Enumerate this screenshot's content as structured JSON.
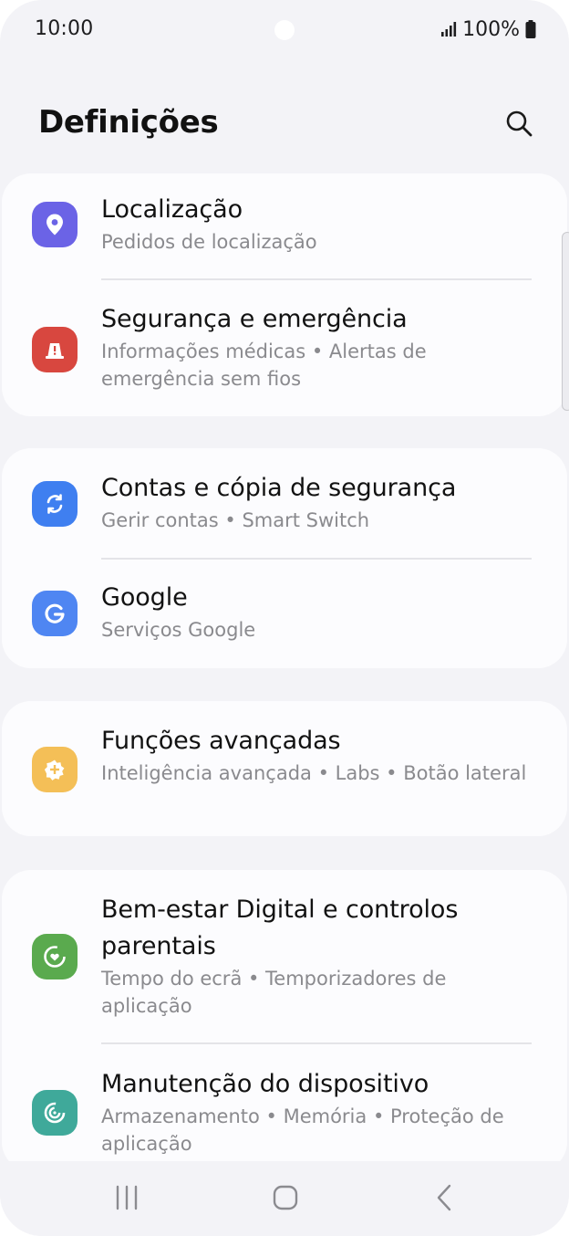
{
  "status_bar": {
    "time": "10:00",
    "battery": "100%",
    "icons": [
      "signal-icon",
      "battery-icon"
    ]
  },
  "header": {
    "title": "Definições",
    "search_icon": "search-icon"
  },
  "cards": [
    {
      "items": [
        {
          "title": "Localização",
          "subtitle": "Pedidos de localização",
          "icon": "location-pin-icon",
          "color": "#6b63e6"
        },
        {
          "title": "Segurança e emergência",
          "subtitle": "Informações médicas  •  Alertas de emergência sem fios",
          "icon": "emergency-alert-icon",
          "color": "#d8473f"
        }
      ]
    },
    {
      "items": [
        {
          "title": "Contas e cópia de segurança",
          "subtitle": "Gerir contas  •  Smart Switch",
          "icon": "sync-icon",
          "color": "#3f7ff0"
        },
        {
          "title": "Google",
          "subtitle": "Serviços Google",
          "icon": "google-g-icon",
          "color": "#4f86f2"
        }
      ]
    },
    {
      "items": [
        {
          "title": "Funções avançadas",
          "subtitle": "Inteligência avançada  •  Labs  •  Botão lateral",
          "icon": "advanced-features-icon",
          "color": "#f4bf57"
        }
      ]
    },
    {
      "items": [
        {
          "title": "Bem-estar Digital e controlos parentais",
          "subtitle": "Tempo do ecrã  •  Temporizadores de aplicação",
          "icon": "digital-wellbeing-icon",
          "color": "#5aaa4e"
        },
        {
          "title": "Manutenção do dispositivo",
          "subtitle": "Armazenamento  •  Memória  •  Proteção de aplicação",
          "icon": "device-care-icon",
          "color": "#3fa99a"
        }
      ]
    }
  ],
  "nav_bar": {
    "icons": [
      "recent-apps-icon",
      "home-icon",
      "back-icon"
    ]
  }
}
